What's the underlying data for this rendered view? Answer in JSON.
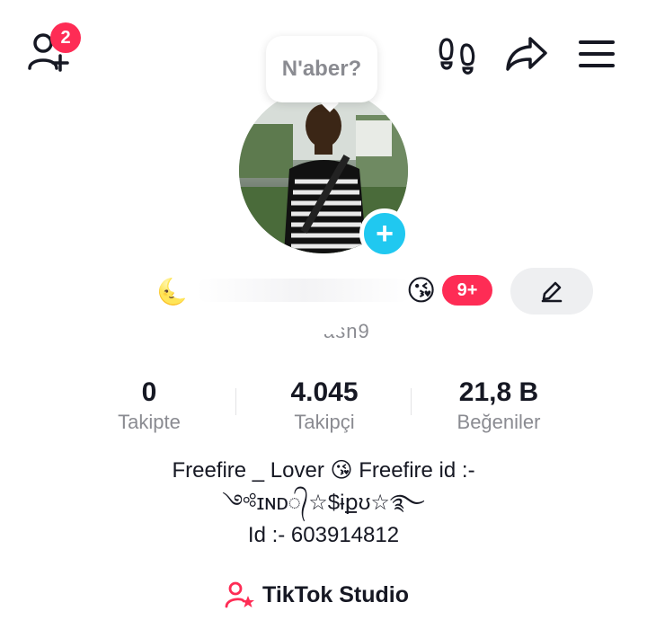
{
  "topbar": {
    "friend_request_count": "2",
    "icons": [
      "add-friend-icon",
      "footprints-icon",
      "share-icon",
      "menu-icon"
    ]
  },
  "avatar": {
    "status_bubble": "N'aber?"
  },
  "profile": {
    "name_emoji_left": "🌜",
    "name_emoji_right": "😘",
    "notification_count": "9+",
    "username_partial": "asn9"
  },
  "stats": {
    "following": {
      "value": "0",
      "label": "Takipte"
    },
    "followers": {
      "value": "4.045",
      "label": "Takipçi"
    },
    "likes": {
      "value": "21,8 B",
      "label": "Beğeniler"
    }
  },
  "bio": {
    "line1": "Freefire _ Lover 😘 Freefire id :-",
    "line2": "༺ɪɴᴅ᭄☆$ɨքʊ☆࿐",
    "line3": "Id :-  603914812"
  },
  "studio": {
    "label": "TikTok Studio"
  },
  "colors": {
    "accent": "#fe2c55",
    "add_button": "#20c8f0",
    "muted_text": "#8a8b91",
    "primary_text": "#161823"
  }
}
